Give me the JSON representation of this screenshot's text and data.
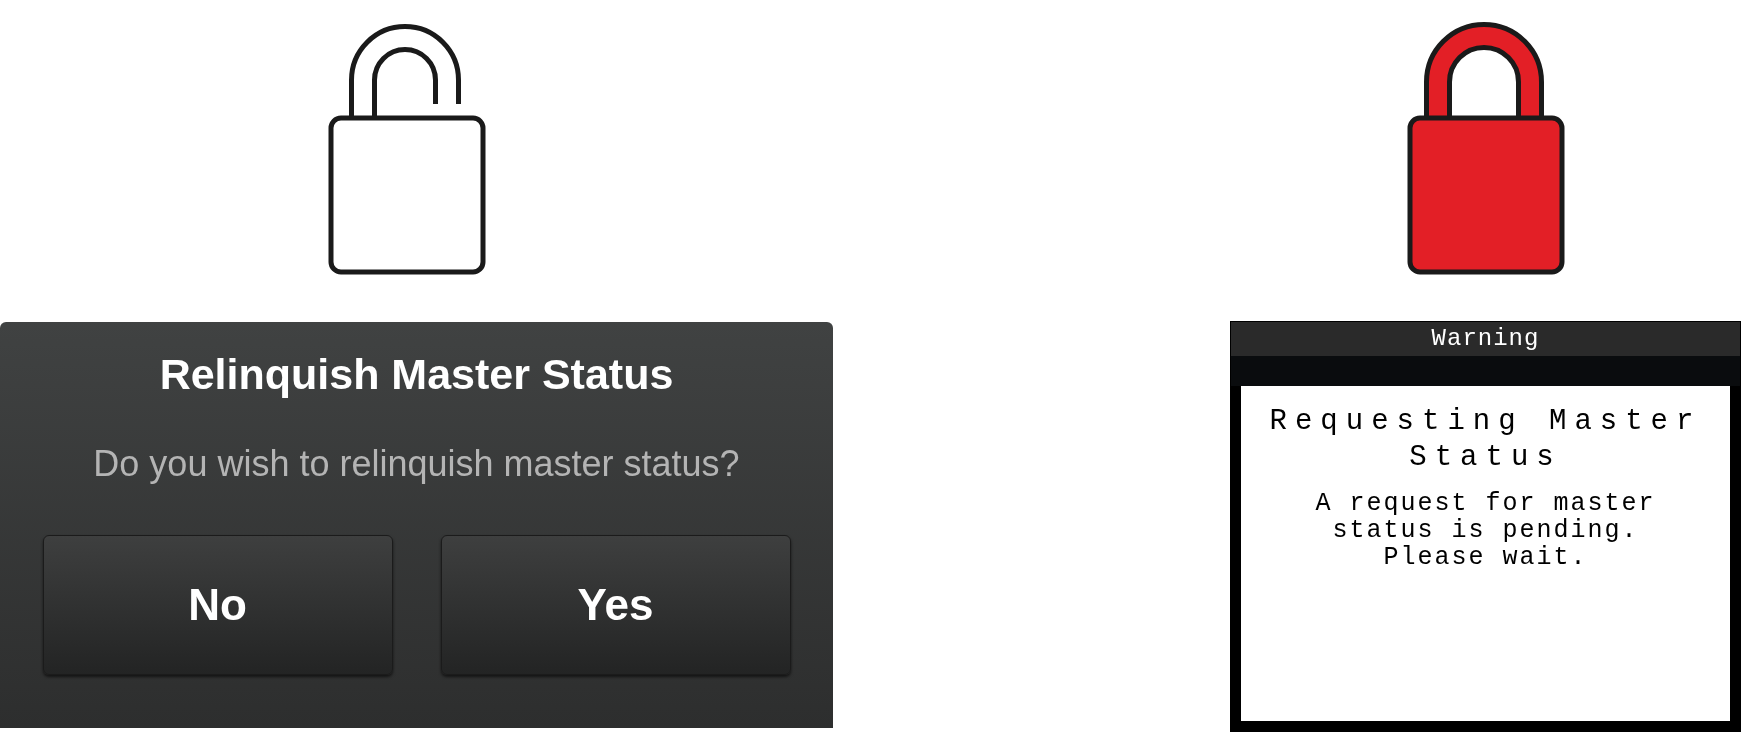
{
  "left": {
    "lock": {
      "locked": false
    },
    "dialog": {
      "title": "Relinquish Master Status",
      "message": "Do you wish to relinquish master status?",
      "buttons": [
        "No",
        "Yes"
      ]
    }
  },
  "right": {
    "lock": {
      "locked": true
    },
    "screen": {
      "title": "Warning",
      "heading": "Requesting Master Status",
      "message": "A request for master status is pending. Please wait."
    }
  }
}
